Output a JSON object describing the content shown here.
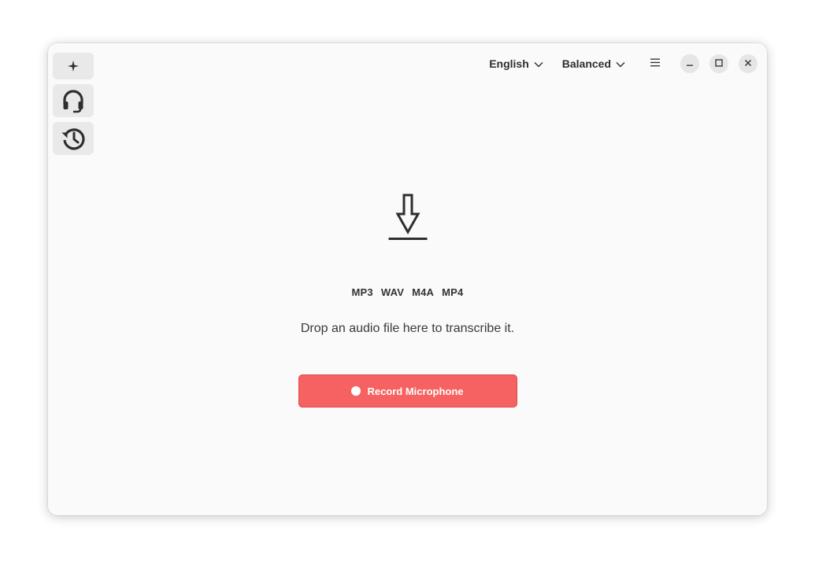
{
  "sidebar": {
    "items": [
      {
        "name": "sparkle-icon"
      },
      {
        "name": "headset-icon"
      },
      {
        "name": "history-icon"
      }
    ]
  },
  "header": {
    "language": "English",
    "model": "Balanced",
    "menu_icon": "hamburger-icon"
  },
  "window_controls": [
    "minimize-icon",
    "maximize-icon",
    "close-icon"
  ],
  "main": {
    "drop_icon": "download-arrow-icon",
    "formats": [
      "MP3",
      "WAV",
      "M4A",
      "MP4"
    ],
    "hint": "Drop an audio file here to transcribe it.",
    "record_label": "Record Microphone"
  },
  "colors": {
    "record_button": "#f66161",
    "window_bg": "#fafafa",
    "sidebar_button_bg": "#e9e9e9"
  }
}
